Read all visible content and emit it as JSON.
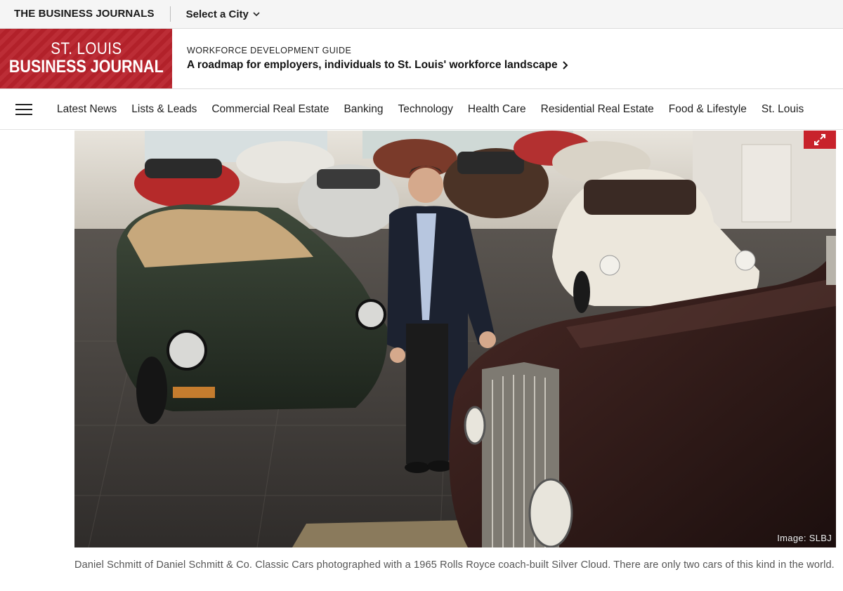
{
  "topbar": {
    "network_name": "THE BUSINESS JOURNALS",
    "city_select_label": "Select a City"
  },
  "brand": {
    "logo_line1": "ST. LOUIS",
    "logo_line2": "BUSINESS JOURNAL",
    "logo_color": "#b8222b"
  },
  "promo": {
    "kicker": "WORKFORCE DEVELOPMENT GUIDE",
    "headline": "A roadmap for employers, individuals to St. Louis' workforce landscape"
  },
  "nav": {
    "menu_icon": "hamburger-icon",
    "items": [
      "Latest News",
      "Lists & Leads",
      "Commercial Real Estate",
      "Banking",
      "Technology",
      "Health Care",
      "Residential Real Estate",
      "Food & Lifestyle",
      "St. Louis"
    ]
  },
  "photo": {
    "credit": "Image: SLBJ",
    "expand_icon": "expand-icon",
    "accent_color": "#c8222b"
  },
  "caption": {
    "text": "Daniel Schmitt of Daniel Schmitt & Co. Classic Cars photographed with a 1965 Rolls Royce coach-built Silver Cloud. There are only two cars of this kind in the world."
  }
}
